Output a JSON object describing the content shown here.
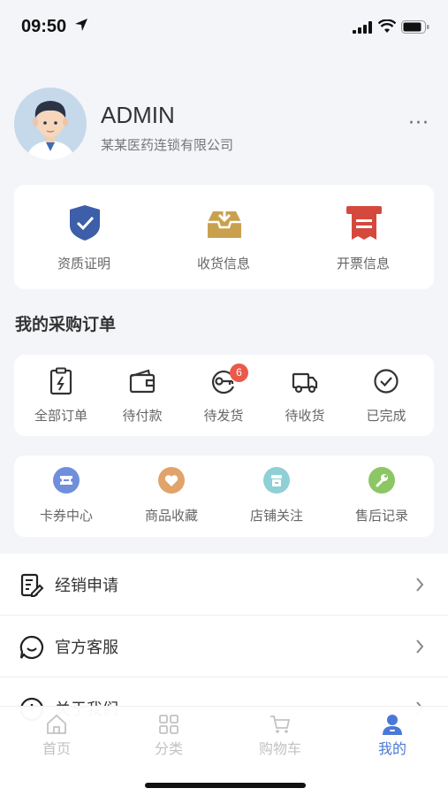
{
  "status_bar": {
    "time": "09:50"
  },
  "profile": {
    "name": "ADMIN",
    "company": "某某医药连锁有限公司",
    "more": "···"
  },
  "quick_actions": [
    {
      "label": "资质证明",
      "icon": "shield-check-icon",
      "color": "#3d5ea9"
    },
    {
      "label": "收货信息",
      "icon": "inbox-download-icon",
      "color": "#c9a14e"
    },
    {
      "label": "开票信息",
      "icon": "invoice-icon",
      "color": "#d5493d"
    }
  ],
  "orders": {
    "title": "我的采购订单",
    "items": [
      {
        "label": "全部订单",
        "icon": "clipboard-icon"
      },
      {
        "label": "待付款",
        "icon": "wallet-icon"
      },
      {
        "label": "待发货",
        "icon": "key-icon",
        "badge": "6"
      },
      {
        "label": "待收货",
        "icon": "truck-icon"
      },
      {
        "label": "已完成",
        "icon": "check-circle-icon"
      }
    ]
  },
  "services": [
    {
      "label": "卡券中心",
      "icon": "ticket-icon",
      "color": "#6f8fdc"
    },
    {
      "label": "商品收藏",
      "icon": "heart-icon",
      "color": "#e0a36b"
    },
    {
      "label": "店铺关注",
      "icon": "store-icon",
      "color": "#8fcfd6"
    },
    {
      "label": "售后记录",
      "icon": "wrench-icon",
      "color": "#8cc665"
    }
  ],
  "menu": [
    {
      "label": "经销申请",
      "icon": "edit-document-icon"
    },
    {
      "label": "官方客服",
      "icon": "chat-smile-icon"
    },
    {
      "label": "关于我们",
      "icon": "info-circle-icon"
    }
  ],
  "tabbar": [
    {
      "label": "首页",
      "icon": "home-icon",
      "active": false
    },
    {
      "label": "分类",
      "icon": "grid-icon",
      "active": false
    },
    {
      "label": "购物车",
      "icon": "cart-icon",
      "active": false
    },
    {
      "label": "我的",
      "icon": "person-icon",
      "active": true
    }
  ],
  "colors": {
    "accent": "#4a78d6",
    "badge": "#e95a4c"
  }
}
